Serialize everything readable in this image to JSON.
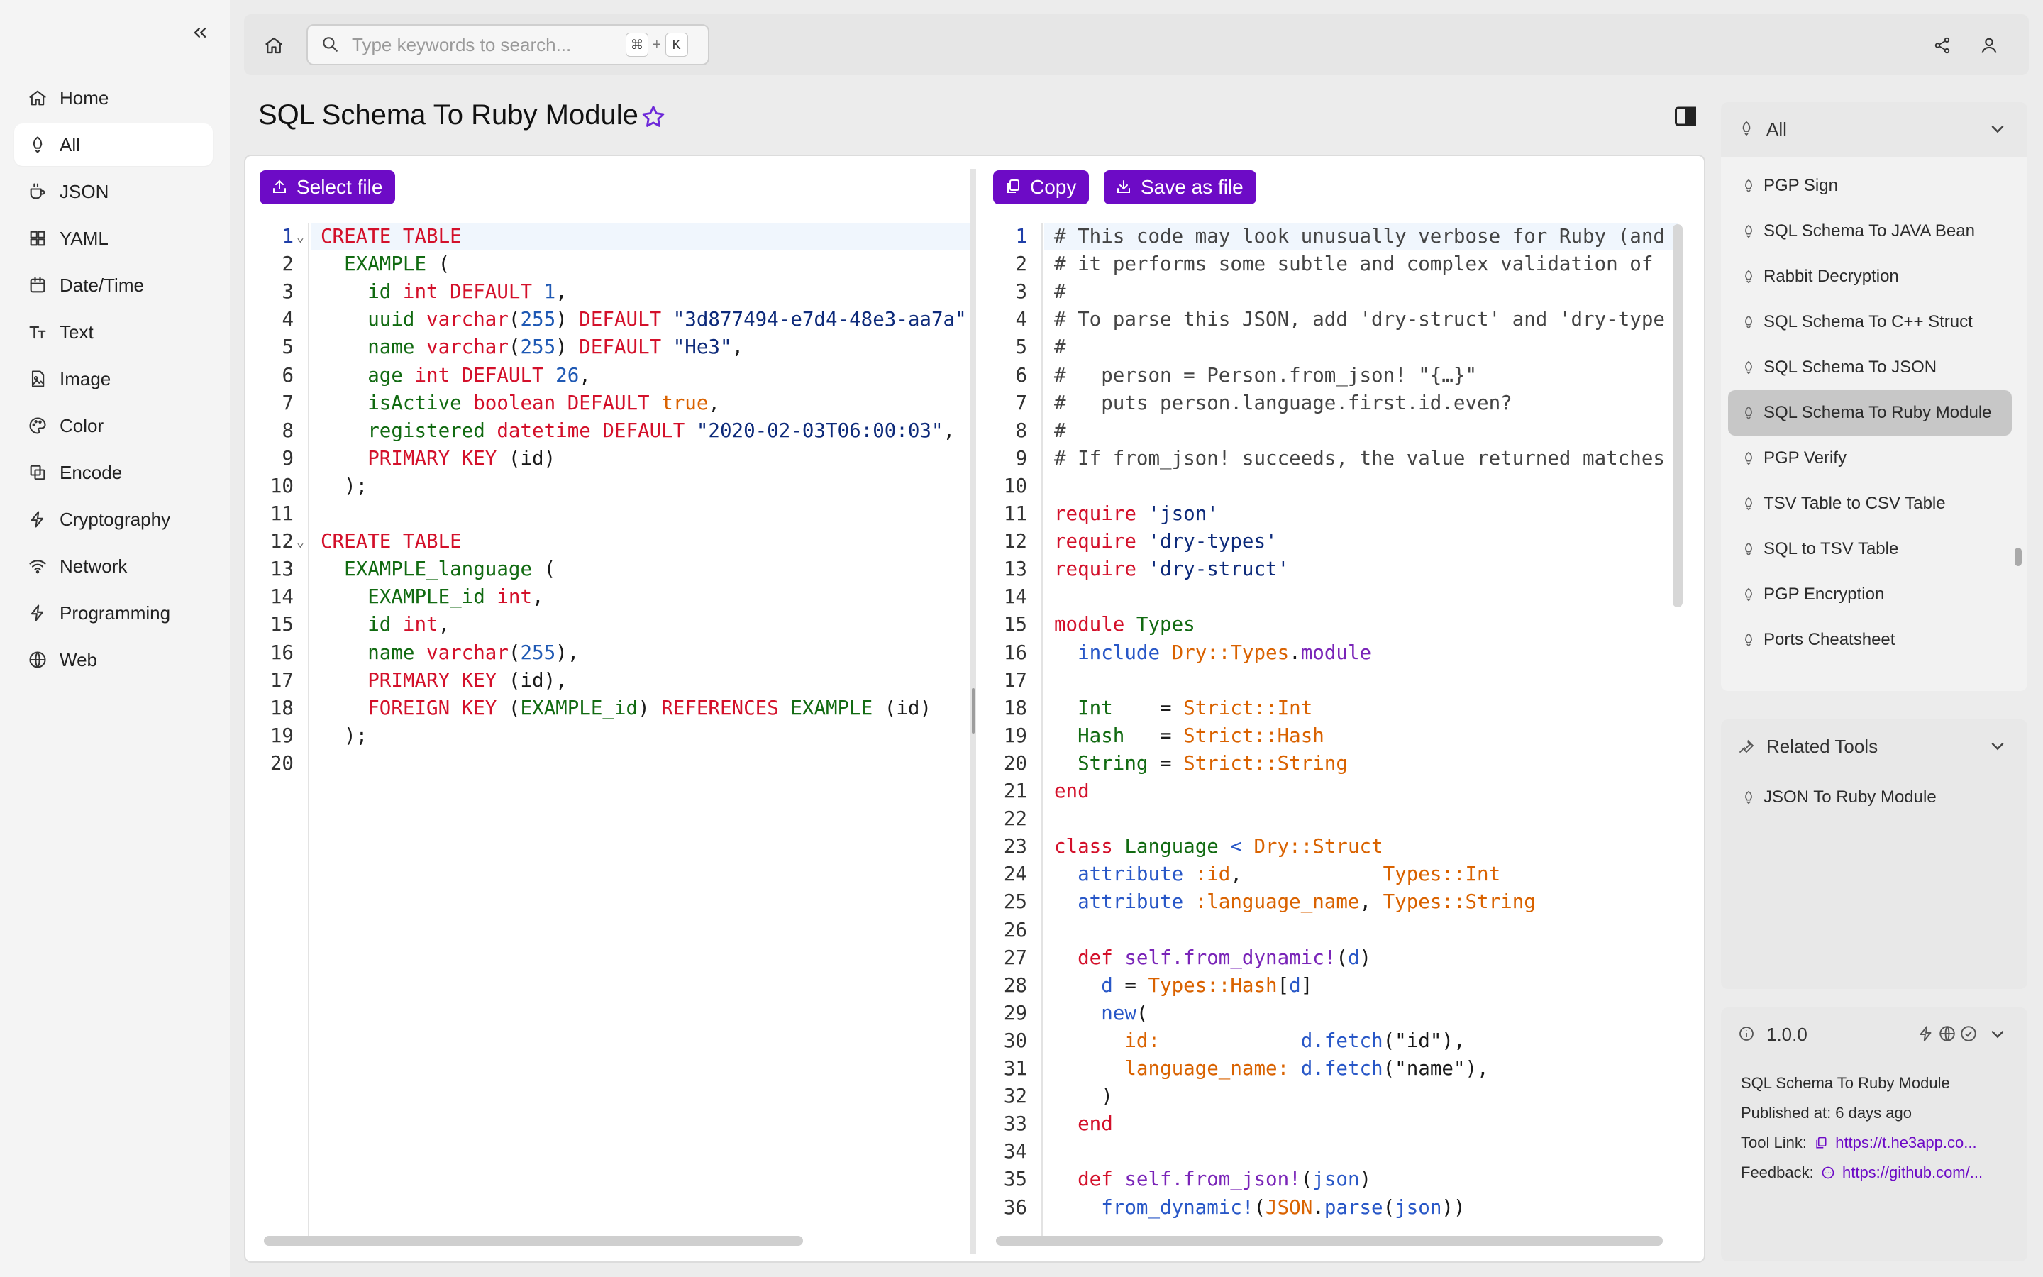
{
  "sidebar": {
    "items": [
      {
        "label": "Home",
        "icon": "home-icon"
      },
      {
        "label": "All",
        "icon": "rocket-icon"
      },
      {
        "label": "JSON",
        "icon": "coffee-icon"
      },
      {
        "label": "YAML",
        "icon": "grid-icon"
      },
      {
        "label": "Date/Time",
        "icon": "calendar-icon"
      },
      {
        "label": "Text",
        "icon": "text-icon"
      },
      {
        "label": "Image",
        "icon": "image-icon"
      },
      {
        "label": "Color",
        "icon": "palette-icon"
      },
      {
        "label": "Encode",
        "icon": "encode-icon"
      },
      {
        "label": "Cryptography",
        "icon": "bolt-icon"
      },
      {
        "label": "Network",
        "icon": "wifi-icon"
      },
      {
        "label": "Programming",
        "icon": "bolt-icon"
      },
      {
        "label": "Web",
        "icon": "globe-icon"
      }
    ]
  },
  "search": {
    "placeholder": "Type keywords to search...",
    "shortcut_mod": "⌘",
    "shortcut_plus": "+",
    "shortcut_key": "K"
  },
  "page": {
    "title": "SQL Schema To Ruby Module"
  },
  "toolbar": {
    "select_file": "Select file",
    "copy": "Copy",
    "save_as_file": "Save as file"
  },
  "input_code": [
    [
      [
        "kw",
        "CREATE TABLE"
      ]
    ],
    [
      [
        "ty",
        "  EXAMPLE"
      ],
      [
        "p",
        " ("
      ]
    ],
    [
      [
        "ty",
        "    id"
      ],
      [
        "p",
        " "
      ],
      [
        "kw",
        "int"
      ],
      [
        "p",
        " "
      ],
      [
        "kw",
        "DEFAULT"
      ],
      [
        "p",
        " "
      ],
      [
        "num",
        "1"
      ],
      [
        "p",
        ","
      ]
    ],
    [
      [
        "ty",
        "    uuid"
      ],
      [
        "p",
        " "
      ],
      [
        "kw",
        "varchar"
      ],
      [
        "p",
        "("
      ],
      [
        "num",
        "255"
      ],
      [
        "p",
        ") "
      ],
      [
        "kw",
        "DEFAULT"
      ],
      [
        "p",
        " "
      ],
      [
        "str",
        "\"3d877494-e7d4-48e3-aa7a\""
      ]
    ],
    [
      [
        "ty",
        "    name"
      ],
      [
        "p",
        " "
      ],
      [
        "kw",
        "varchar"
      ],
      [
        "p",
        "("
      ],
      [
        "num",
        "255"
      ],
      [
        "p",
        ") "
      ],
      [
        "kw",
        "DEFAULT"
      ],
      [
        "p",
        " "
      ],
      [
        "str",
        "\"He3\""
      ],
      [
        "p",
        ","
      ]
    ],
    [
      [
        "ty",
        "    age"
      ],
      [
        "p",
        " "
      ],
      [
        "kw",
        "int"
      ],
      [
        "p",
        " "
      ],
      [
        "kw",
        "DEFAULT"
      ],
      [
        "p",
        " "
      ],
      [
        "num",
        "26"
      ],
      [
        "p",
        ","
      ]
    ],
    [
      [
        "ty",
        "    isActive"
      ],
      [
        "p",
        " "
      ],
      [
        "kw",
        "boolean"
      ],
      [
        "p",
        " "
      ],
      [
        "kw",
        "DEFAULT"
      ],
      [
        "p",
        " "
      ],
      [
        "bool",
        "true"
      ],
      [
        "p",
        ","
      ]
    ],
    [
      [
        "ty",
        "    registered"
      ],
      [
        "p",
        " "
      ],
      [
        "kw",
        "datetime"
      ],
      [
        "p",
        " "
      ],
      [
        "kw",
        "DEFAULT"
      ],
      [
        "p",
        " "
      ],
      [
        "str",
        "\"2020-02-03T06:00:03\""
      ],
      [
        "p",
        ","
      ]
    ],
    [
      [
        "kw",
        "    PRIMARY KEY"
      ],
      [
        "p",
        " (id)"
      ]
    ],
    [
      [
        "p",
        "  );"
      ]
    ],
    [
      [
        "p",
        ""
      ]
    ],
    [
      [
        "kw",
        "CREATE TABLE"
      ]
    ],
    [
      [
        "ty",
        "  EXAMPLE_language"
      ],
      [
        "p",
        " ("
      ]
    ],
    [
      [
        "ty",
        "    EXAMPLE_id"
      ],
      [
        "p",
        " "
      ],
      [
        "kw",
        "int"
      ],
      [
        "p",
        ","
      ]
    ],
    [
      [
        "ty",
        "    id"
      ],
      [
        "p",
        " "
      ],
      [
        "kw",
        "int"
      ],
      [
        "p",
        ","
      ]
    ],
    [
      [
        "ty",
        "    name"
      ],
      [
        "p",
        " "
      ],
      [
        "kw",
        "varchar"
      ],
      [
        "p",
        "("
      ],
      [
        "num",
        "255"
      ],
      [
        "p",
        "),"
      ]
    ],
    [
      [
        "kw",
        "    PRIMARY KEY"
      ],
      [
        "p",
        " (id),"
      ]
    ],
    [
      [
        "kw",
        "    FOREIGN KEY"
      ],
      [
        "p",
        " ("
      ],
      [
        "ty",
        "EXAMPLE_id"
      ],
      [
        "p",
        ") "
      ],
      [
        "kw",
        "REFERENCES"
      ],
      [
        "p",
        " "
      ],
      [
        "ty",
        "EXAMPLE"
      ],
      [
        "p",
        " (id)"
      ]
    ],
    [
      [
        "p",
        "  );"
      ]
    ],
    [
      [
        "p",
        ""
      ]
    ]
  ],
  "output_code": [
    [
      [
        "com",
        "# This code may look unusually verbose for Ruby (and"
      ]
    ],
    [
      [
        "com",
        "# it performs some subtle and complex validation of"
      ]
    ],
    [
      [
        "com",
        "#"
      ]
    ],
    [
      [
        "com",
        "# To parse this JSON, add 'dry-struct' and 'dry-type"
      ]
    ],
    [
      [
        "com",
        "#"
      ]
    ],
    [
      [
        "com",
        "#   person = Person.from_json! \"{…}\""
      ]
    ],
    [
      [
        "com",
        "#   puts person.language.first.id.even?"
      ]
    ],
    [
      [
        "com",
        "#"
      ]
    ],
    [
      [
        "com",
        "# If from_json! succeeds, the value returned matches"
      ]
    ],
    [
      [
        "p",
        ""
      ]
    ],
    [
      [
        "kw",
        "require"
      ],
      [
        "p",
        " "
      ],
      [
        "str",
        "'json'"
      ]
    ],
    [
      [
        "kw",
        "require"
      ],
      [
        "p",
        " "
      ],
      [
        "str",
        "'dry-types'"
      ]
    ],
    [
      [
        "kw",
        "require"
      ],
      [
        "p",
        " "
      ],
      [
        "str",
        "'dry-struct'"
      ]
    ],
    [
      [
        "p",
        ""
      ]
    ],
    [
      [
        "kw",
        "module"
      ],
      [
        "p",
        " "
      ],
      [
        "green",
        "Types"
      ]
    ],
    [
      [
        "sym",
        "  include"
      ],
      [
        "p",
        " "
      ],
      [
        "const",
        "Dry::Types"
      ],
      [
        "p",
        "."
      ],
      [
        "purp",
        "module"
      ]
    ],
    [
      [
        "p",
        ""
      ]
    ],
    [
      [
        "green",
        "  Int"
      ],
      [
        "p",
        "    = "
      ],
      [
        "const",
        "Strict::Int"
      ]
    ],
    [
      [
        "green",
        "  Hash"
      ],
      [
        "p",
        "   = "
      ],
      [
        "const",
        "Strict::Hash"
      ]
    ],
    [
      [
        "green",
        "  String"
      ],
      [
        "p",
        " = "
      ],
      [
        "const",
        "Strict::String"
      ]
    ],
    [
      [
        "kw",
        "end"
      ]
    ],
    [
      [
        "p",
        ""
      ]
    ],
    [
      [
        "kw",
        "class"
      ],
      [
        "p",
        " "
      ],
      [
        "green",
        "Language"
      ],
      [
        "p",
        " "
      ],
      [
        "sym",
        "<"
      ],
      [
        "p",
        " "
      ],
      [
        "const",
        "Dry::Struct"
      ]
    ],
    [
      [
        "sym",
        "  attribute"
      ],
      [
        "p",
        " "
      ],
      [
        "const",
        ":id"
      ],
      [
        "p",
        ",            "
      ],
      [
        "const",
        "Types::Int"
      ]
    ],
    [
      [
        "sym",
        "  attribute"
      ],
      [
        "p",
        " "
      ],
      [
        "const",
        ":language_name"
      ],
      [
        "p",
        ", "
      ],
      [
        "const",
        "Types::String"
      ]
    ],
    [
      [
        "p",
        ""
      ]
    ],
    [
      [
        "kw",
        "  def"
      ],
      [
        "p",
        " "
      ],
      [
        "purp",
        "self.from_dynamic!"
      ],
      [
        "p",
        "("
      ],
      [
        "sym",
        "d"
      ],
      [
        "p",
        ")"
      ]
    ],
    [
      [
        "sym",
        "    d"
      ],
      [
        "p",
        " = "
      ],
      [
        "const",
        "Types::Hash"
      ],
      [
        "p",
        "["
      ],
      [
        "sym",
        "d"
      ],
      [
        "p",
        "]"
      ]
    ],
    [
      [
        "sym",
        "    new"
      ],
      [
        "p",
        "("
      ]
    ],
    [
      [
        "const",
        "      id:"
      ],
      [
        "p",
        "            "
      ],
      [
        "sym",
        "d.fetch"
      ],
      [
        "p",
        "(\"id\"),"
      ]
    ],
    [
      [
        "const",
        "      language_name:"
      ],
      [
        "p",
        " "
      ],
      [
        "sym",
        "d.fetch"
      ],
      [
        "p",
        "(\"name\"),"
      ]
    ],
    [
      [
        "p",
        "    )"
      ]
    ],
    [
      [
        "kw",
        "  end"
      ]
    ],
    [
      [
        "p",
        ""
      ]
    ],
    [
      [
        "kw",
        "  def"
      ],
      [
        "p",
        " "
      ],
      [
        "purp",
        "self.from_json!"
      ],
      [
        "p",
        "("
      ],
      [
        "sym",
        "json"
      ],
      [
        "p",
        ")"
      ]
    ],
    [
      [
        "sym",
        "    from_dynamic!"
      ],
      [
        "p",
        "("
      ],
      [
        "const",
        "JSON"
      ],
      [
        "p",
        "."
      ],
      [
        "sym",
        "parse"
      ],
      [
        "p",
        "("
      ],
      [
        "sym",
        "json"
      ],
      [
        "p",
        "))"
      ]
    ]
  ],
  "tool_list": {
    "header": "All",
    "items": [
      "PGP Sign",
      "SQL Schema To JAVA Bean",
      "Rabbit Decryption",
      "SQL Schema To C++ Struct",
      "SQL Schema To JSON",
      "SQL Schema To Ruby Module",
      "PGP Verify",
      "TSV Table to CSV Table",
      "SQL to TSV Table",
      "PGP Encryption",
      "Ports Cheatsheet"
    ]
  },
  "related": {
    "header": "Related Tools",
    "items": [
      "JSON To Ruby Module"
    ]
  },
  "info": {
    "version": "1.0.0",
    "name": "SQL Schema To Ruby Module",
    "published": "Published at: 6 days ago",
    "tool_link_label": "Tool Link:",
    "tool_link": "https://t.he3app.co...",
    "feedback_label": "Feedback:",
    "feedback_link": "https://github.com/..."
  },
  "colors": {
    "accent": "#6d0bc6",
    "keyword": "#d3102a",
    "type": "#116a11",
    "number": "#1f59b4",
    "bool": "#d96200"
  }
}
